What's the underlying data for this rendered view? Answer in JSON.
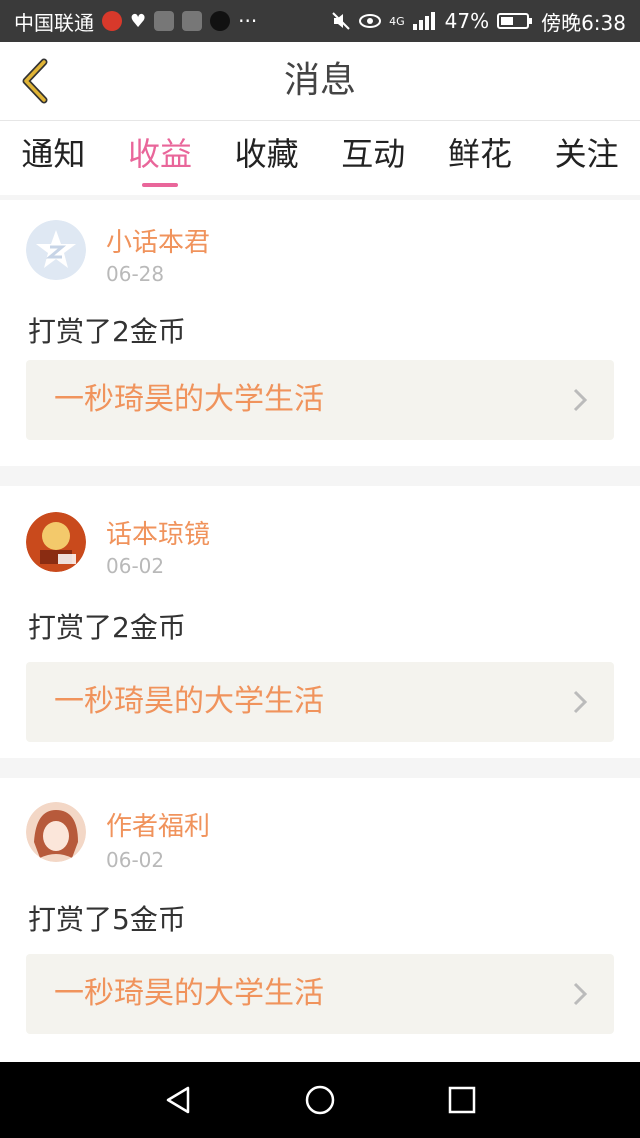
{
  "status_bar": {
    "carrier": "中国联通",
    "more": "···",
    "network": "4G",
    "battery": "47%",
    "time": "傍晚6:38"
  },
  "header": {
    "title": "消息"
  },
  "tabs": [
    {
      "label": "通知",
      "active": false
    },
    {
      "label": "收益",
      "active": true
    },
    {
      "label": "收藏",
      "active": false
    },
    {
      "label": "互动",
      "active": false
    },
    {
      "label": "鲜花",
      "active": false
    },
    {
      "label": "关注",
      "active": false
    }
  ],
  "cards": [
    {
      "name": "小话本君",
      "date": "06-28",
      "message": "打赏了2金币",
      "link": "一秒琦昊的大学生活",
      "avatar": "default-avatar-icon"
    },
    {
      "name": "话本琼镜",
      "date": "06-02",
      "message": "打赏了2金币",
      "link": "一秒琦昊的大学生活",
      "avatar": "user-avatar"
    },
    {
      "name": "作者福利",
      "date": "06-02",
      "message": "打赏了5金币",
      "link": "一秒琦昊的大学生活",
      "avatar": "user-avatar"
    }
  ],
  "colors": {
    "accent": "#e9669a",
    "orange": "#f0935c",
    "back_arrow": "#e0b436"
  }
}
